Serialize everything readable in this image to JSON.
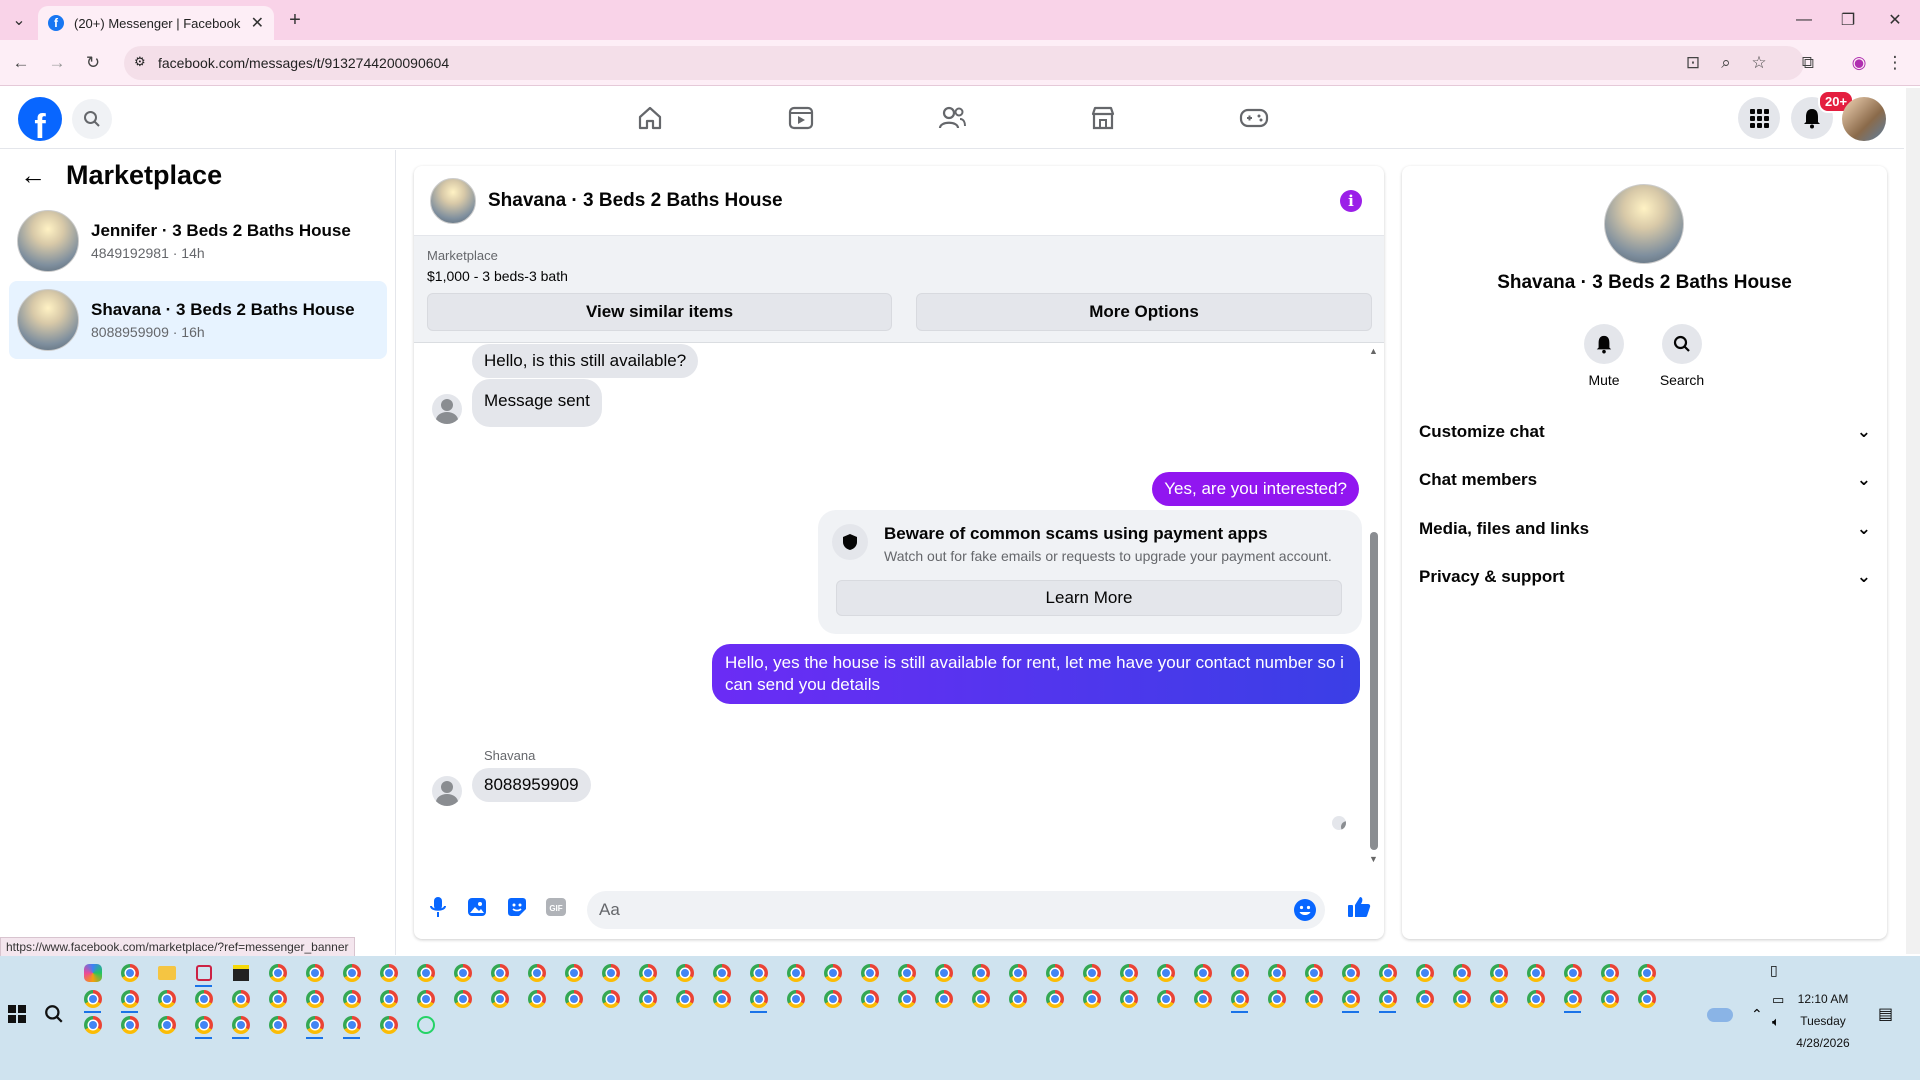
{
  "browser": {
    "tab_title": "(20+) Messenger | Facebook",
    "url": "facebook.com/messages/t/9132744200090604",
    "status_url": "https://www.facebook.com/marketplace/?ref=messenger_banner"
  },
  "fb": {
    "notification_badge": "20+"
  },
  "sidebar": {
    "title": "Marketplace",
    "conversations": [
      {
        "name": "Jennifer · 3 Beds 2 Baths House",
        "sub": "4849192981 · 14h"
      },
      {
        "name": "Shavana · 3 Beds 2 Baths House",
        "sub": "8088959909 · 16h"
      }
    ]
  },
  "chat": {
    "title": "Shavana · 3 Beds 2 Baths House",
    "listing_label": "Marketplace",
    "listing_price": "$1,000 - 3 beds-3 bath",
    "view_similar": "View similar items",
    "more_options": "More Options",
    "messages": {
      "m1": "Hello, is this still available?",
      "m2": "Message sent",
      "m3": "Yes, are you interested?",
      "m4": "Hello, yes the house is still available for rent, let me have your contact number so i can send you details",
      "sender": "Shavana",
      "m5": "8088959909"
    },
    "scam": {
      "title": "Beware of common scams using payment apps",
      "body": "Watch out for fake emails or requests to upgrade your payment account.",
      "learn_more": "Learn More"
    },
    "input_placeholder": "Aa"
  },
  "details": {
    "name": "Shavana · 3 Beds 2 Baths House",
    "mute": "Mute",
    "search": "Search",
    "sections": [
      "Customize chat",
      "Chat members",
      "Media, files and links",
      "Privacy & support"
    ]
  },
  "taskbar": {
    "time": "12:10 AM",
    "day": "Tuesday",
    "date": "4/28/2026"
  },
  "colors": {
    "fb_blue": "#0866ff",
    "outgoing": "#9116f0",
    "accent_purple": "#9b1fe8"
  }
}
